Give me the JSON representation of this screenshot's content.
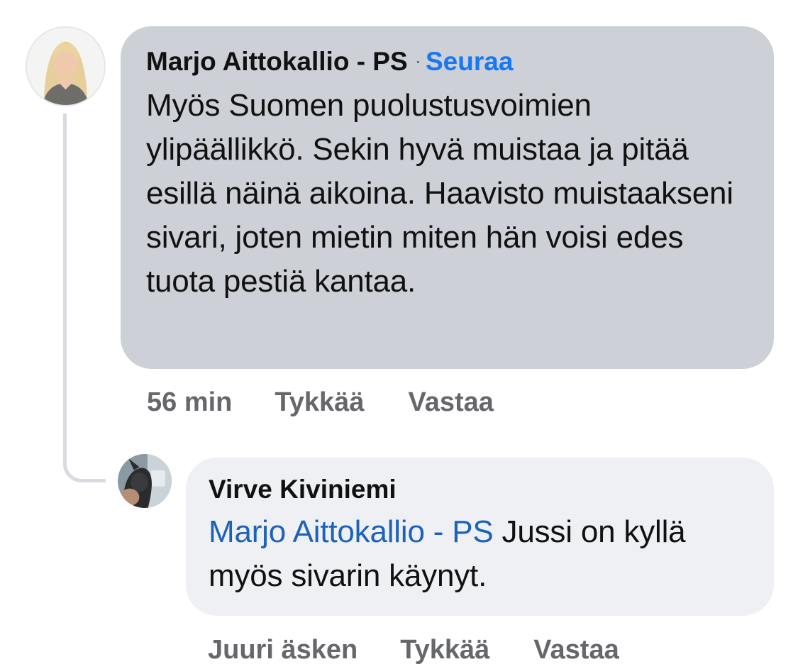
{
  "comment": {
    "author": "Marjo Aittokallio - PS",
    "separator": "·",
    "follow_label": "Seuraa",
    "text": "Myös Suomen puolustusvoimien ylipäällikkö. Sekin hyvä muistaa ja pitää esillä näinä aikoina. Haavisto muistaakseni sivari, joten mietin miten hän voisi edes tuota pestiä kantaa.",
    "time": "56 min",
    "like_label": "Tykkää",
    "reply_label": "Vastaa"
  },
  "reply": {
    "author": "Virve Kiviniemi",
    "mention": "Marjo Aittokallio - PS",
    "text": " Jussi on kyllä myös sivarin käynyt.",
    "time": "Juuri äsken",
    "like_label": "Tykkää",
    "reply_label": "Vastaa"
  },
  "colors": {
    "comment_bubble": "#cdd0d6",
    "reply_bubble": "#eef0f3",
    "link_blue": "#1877f2",
    "mention_blue": "#1c62b9",
    "meta_gray": "#65676b"
  }
}
